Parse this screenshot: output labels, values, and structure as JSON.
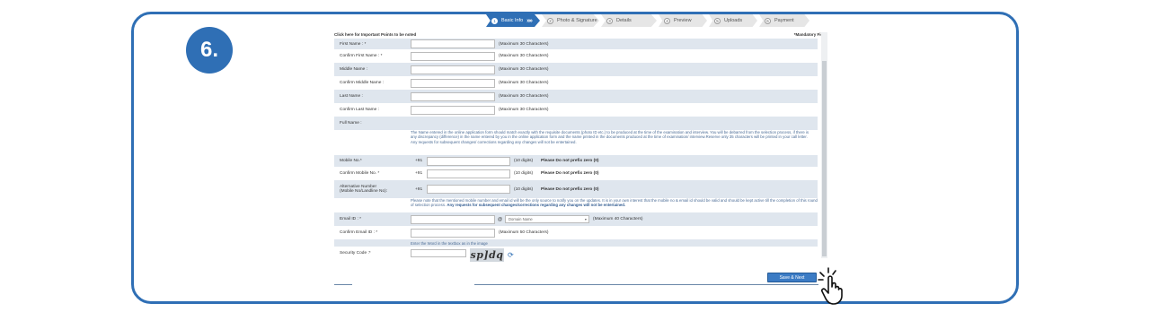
{
  "step_badge": "6.",
  "progress": [
    {
      "num": "1",
      "label": "Basic Info",
      "active": true
    },
    {
      "num": "2",
      "label": "Photo & Signature",
      "active": false
    },
    {
      "num": "3",
      "label": "Details",
      "active": false
    },
    {
      "num": "4",
      "label": "Preview",
      "active": false
    },
    {
      "num": "5",
      "label": "Uploads",
      "active": false
    },
    {
      "num": "6",
      "label": "Payment",
      "active": false
    }
  ],
  "progress_arrows": "»»",
  "hint": "Click here for Important Points to be noted",
  "mandatory": "*Mandatory Field",
  "fields": {
    "first_name": {
      "label": "First Name : *",
      "note": "(Maximum 30 Characters)"
    },
    "confirm_first_name": {
      "label": "Confirm First Name : *",
      "note": "(Maximum 30 Characters)"
    },
    "middle_name": {
      "label": "Middle Name :",
      "note": "(Maximum 30 Characters)"
    },
    "confirm_middle_name": {
      "label": "Confirm Middle Name :",
      "note": "(Maximum 30 Characters)"
    },
    "last_name": {
      "label": "Last Name :",
      "note": "(Maximum 30 Characters)"
    },
    "confirm_last_name": {
      "label": "Confirm Last Name :",
      "note": "(Maximum 30 Characters)"
    },
    "full_name": {
      "label": "Full Name :"
    }
  },
  "name_para": "The Name entered in the online application form should match exactly with the requisite documents (photo ID etc.) to be produced at the time of the examination and interview. You will be debarred from the selection process, if there is any discrepancy (difference) in the name entered by you in the online application form and the name printed in the documents produced at the time of examination/ interview.Reserve only 35 characters will be printed in your call letter. Any requests for subsequent changes/ corrections regarding any changes will not be entertained.",
  "phones": {
    "mobile": {
      "label": "Mobile No.*",
      "prefix": "+91",
      "digits": "(10 digits)",
      "warn": "Please Do not prefix zero (0)"
    },
    "confirm_mobile": {
      "label": "Confirm Mobile No. *",
      "prefix": "+91",
      "digits": "(10 digits)",
      "warn": "Please Do not prefix zero (0)"
    },
    "alternative": {
      "label1": "Alternative Number",
      "label2": "(Mobile No/Landline No):",
      "prefix": "+91",
      "digits": "(10 digits)",
      "warn": "Please Do not prefix zero (0)"
    }
  },
  "email_para": "Please note that the mentioned mobile number and email id will be the only source to notify you on the updates. It is in your own interest that the mobile no & email id should be valid and should be kept active till the completion of this round of selection process.",
  "email_para_bold": "Any requests for subsequent changes/corrections regarding any changes will not be entertained.",
  "email": {
    "label": "Email ID : *",
    "at": "@",
    "domain_placeholder": "Domain Name",
    "note": "(Maximum 40 Characters)"
  },
  "confirm_email": {
    "label": "Confirm Email ID : *",
    "note": "(Maximum 50 Characters)"
  },
  "captcha_hint": "Enter the Word in the textbox as in the image",
  "security": {
    "label": "Security Code :*",
    "captcha_text": "sp]dq"
  },
  "save_button": "Save & Next"
}
